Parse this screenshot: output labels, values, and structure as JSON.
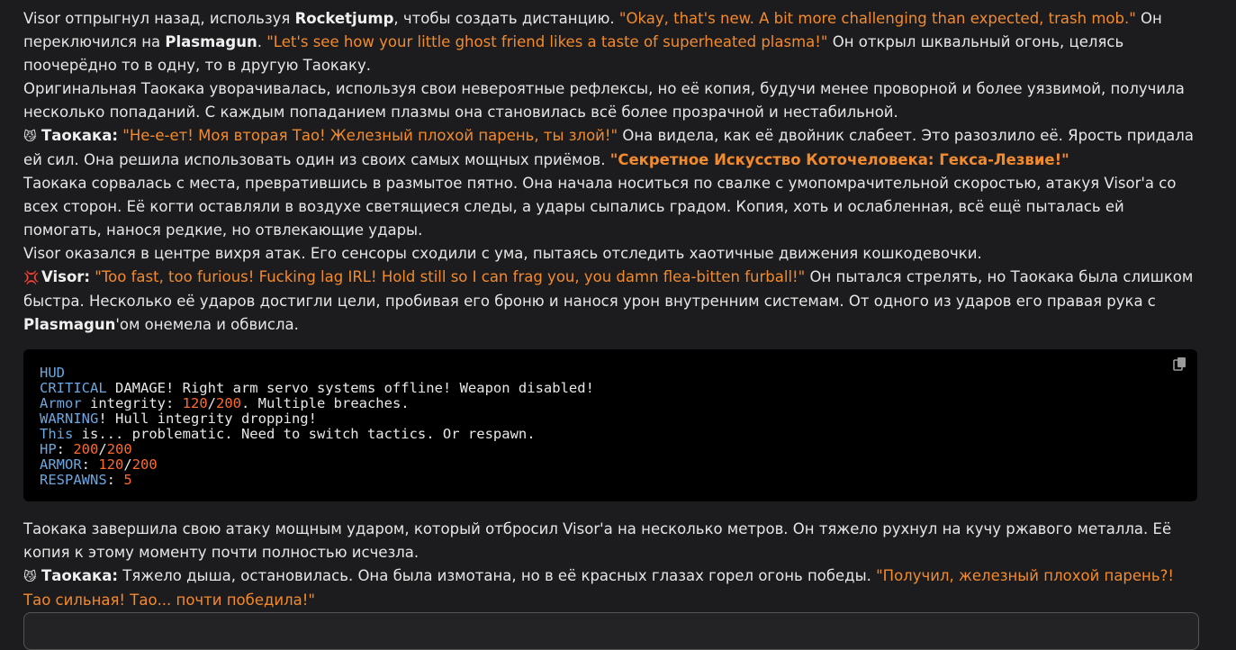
{
  "paragraphs_before": {
    "p1_a": "Visor отпрыгнул назад, используя ",
    "p1_b": "Rocketjump",
    "p1_c": ", чтобы создать дистанцию. ",
    "p1_q1": "\"Okay, that's new. A bit more challenging than expected, trash mob.\"",
    "p1_d": " Он переключился на ",
    "p1_e": "Plasmagun",
    "p1_f": ". ",
    "p1_q2": "\"Let's see how your little ghost friend likes a taste of superheated plasma!\"",
    "p1_g": " Он открыл шквальный огонь, целясь поочерёдно то в одну, то в другую Таокаку.",
    "p2": "Оригинальная Таокака уворачивалась, используя свои невероятные рефлексы, но её копия, будучи менее проворной и более уязвимой, получила несколько попаданий. С каждым попаданием плазмы она становилась всё более прозрачной и нестабильной.",
    "p3_emoji": "😼",
    "p3_speaker": "Таокака:",
    "p3_q": "\"Не-е-ет! Моя вторая Тао! Железный плохой парень, ты злой!\"",
    "p3_a": " Она видела, как её двойник слабеет. Это разозлило её. Ярость придала ей сил. Она решила использовать один из своих самых мощных приёмов. ",
    "p3_qb": "\"Секретное Искусство Коточеловека: Гекса-Лезвие!\"",
    "p4": "Таокака сорвалась с места, превратившись в размытое пятно. Она начала носиться по свалке с умопомрачительной скоростью, атакуя Visor'а со всех сторон. Её когти оставляли в воздухе светящиеся следы, а удары сыпались градом. Копия, хоть и ослабленная, всё ещё пыталась ей помогать, нанося редкие, но отвлекающие удары.",
    "p5": "Visor оказался в центре вихря атак. Его сенсоры сходили с ума, пытаясь отследить хаотичные движения кошкодевочки.",
    "p6_emoji": "💢",
    "p6_speaker": "Visor:",
    "p6_q": "\"Too fast, too furious! Fucking lag IRL! Hold still so I can frag you, you damn flea-bitten furball!\"",
    "p6_a": " Он пытался стрелять, но Таокака была слишком быстра. Несколько её ударов достигли цели, пробивая его броню и нанося урон внутренним системам. От одного из ударов его правая рука с ",
    "p6_b": "Plasmagun",
    "p6_c": "'ом онемела и обвисла."
  },
  "code": {
    "l1": "HUD",
    "l2_kw": "CRITICAL",
    "l2_rest": " DAMAGE! Right arm servo systems offline! Weapon disabled!",
    "l3_kw": "Armor",
    "l3_a": " integrity: ",
    "l3_n1": "120",
    "l3_s": "/",
    "l3_n2": "200",
    "l3_b": ". Multiple breaches.",
    "l4_kw": "WARNING",
    "l4_rest": "! Hull integrity dropping!",
    "l5_kw": "This",
    "l5_rest": " is... problematic. Need to switch tactics. Or respawn.",
    "l6_kw": "HP",
    "l6_c": ": ",
    "l6_n1": "200",
    "l6_s": "/",
    "l6_n2": "200",
    "l7_kw": "ARMOR",
    "l7_c": ": ",
    "l7_n1": "120",
    "l7_s": "/",
    "l7_n2": "200",
    "l8_kw": "RESPAWNS",
    "l8_c": ": ",
    "l8_n": "5",
    "copy_icon": "copy-icon"
  },
  "paragraphs_after": {
    "p7": "Таокака завершила свою атаку мощным ударом, который отбросил Visor'а на несколько метров. Он тяжело рухнул на кучу ржавого металла. Её копия к этому моменту почти полностью исчезла.",
    "p8_emoji": "😼",
    "p8_speaker": "Таокака:",
    "p8_a": " Тяжело дыша, остановилась. Она была измотана, но в её красных глазах горел огонь победы. ",
    "p8_q": "\"Получил, железный плохой парень?! Тао сильная! Тао... почти победила!\""
  }
}
